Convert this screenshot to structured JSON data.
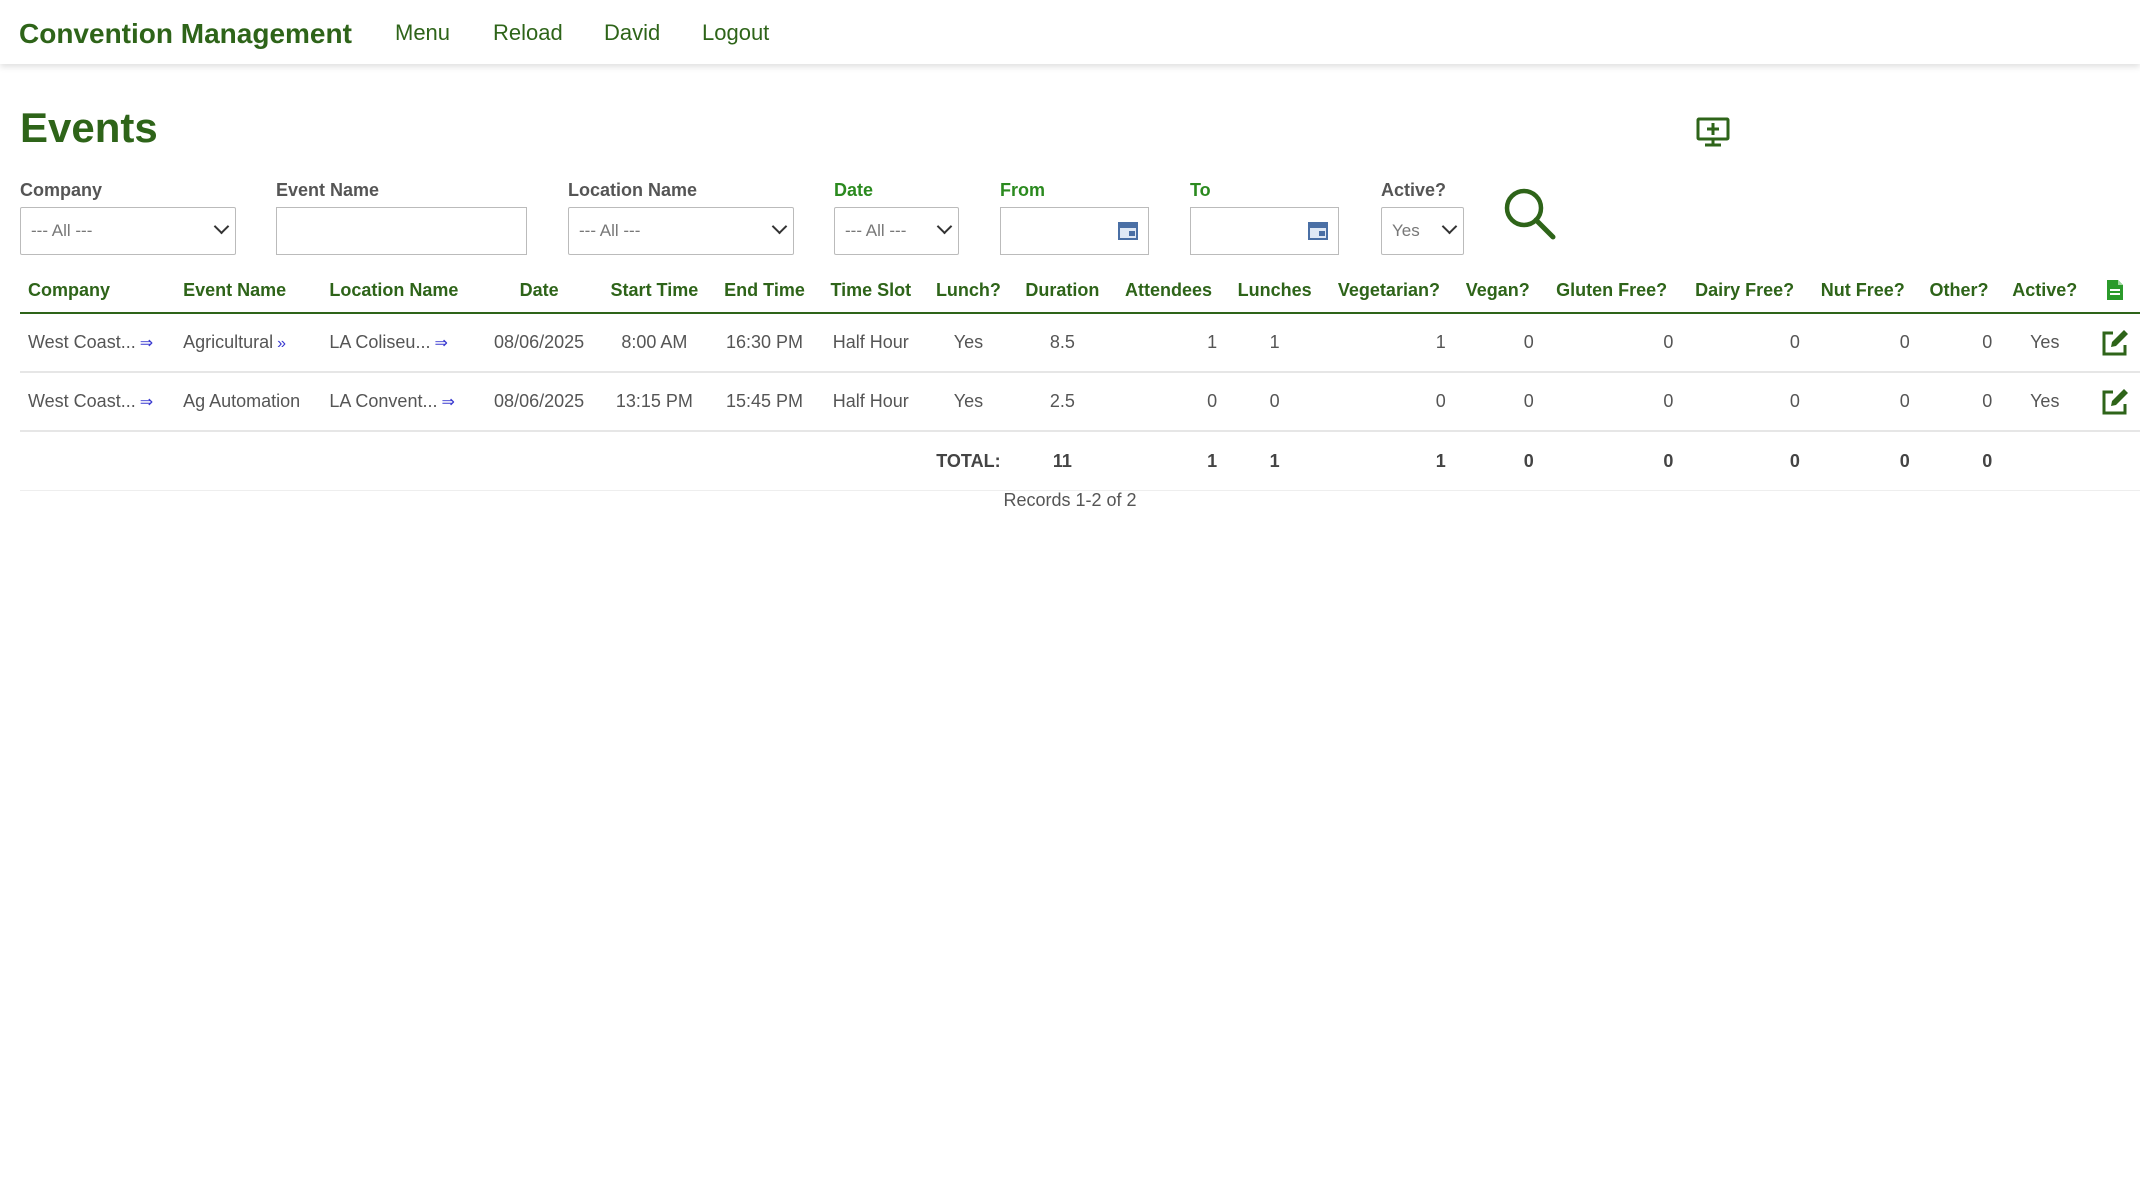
{
  "app": {
    "title": "Convention Management"
  },
  "nav": {
    "menu": "Menu",
    "reload": "Reload",
    "user": "David",
    "logout": "Logout"
  },
  "page": {
    "title": "Events"
  },
  "filters": {
    "company": {
      "label": "Company",
      "value": "--- All ---"
    },
    "event_name": {
      "label": "Event Name",
      "value": ""
    },
    "location_name": {
      "label": "Location Name",
      "value": "--- All ---"
    },
    "date": {
      "label": "Date",
      "value": "--- All ---"
    },
    "from": {
      "label": "From",
      "value": ""
    },
    "to": {
      "label": "To",
      "value": ""
    },
    "active": {
      "label": "Active?",
      "value": "Yes"
    }
  },
  "table": {
    "headers": [
      "Company",
      "Event Name",
      "Location Name",
      "Date",
      "Start Time",
      "End Time",
      "Time Slot",
      "Lunch?",
      "Duration",
      "Attendees",
      "Lunches",
      "Vegetarian?",
      "Vegan?",
      "Gluten Free?",
      "Dairy Free?",
      "Nut Free?",
      "Other?",
      "Active?"
    ],
    "rows": [
      [
        "West Coast...",
        "Agricultural",
        "LA Coliseu...",
        "08/06/2025",
        "8:00 AM",
        "16:30 PM",
        "Half Hour",
        "Yes",
        "8.5",
        "1",
        "1",
        "1",
        "0",
        "0",
        "0",
        "0",
        "0",
        "Yes"
      ],
      [
        "West Coast...",
        "Ag Automation",
        "LA Convent...",
        "08/06/2025",
        "13:15 PM",
        "15:45 PM",
        "Half Hour",
        "Yes",
        "2.5",
        "0",
        "0",
        "0",
        "0",
        "0",
        "0",
        "0",
        "0",
        "Yes"
      ]
    ],
    "total": {
      "label": "TOTAL:",
      "duration": "11",
      "attendees": "1",
      "lunches": "1",
      "vegetarian": "1",
      "vegan": "0",
      "gluten_free": "0",
      "dairy_free": "0",
      "nut_free": "0",
      "other": "0"
    }
  },
  "footer": {
    "records": "Records 1-2 of 2"
  },
  "colors": {
    "brand": "#2e6419",
    "date": "#2b8a1f",
    "link_arrow": "#3a3ad0"
  },
  "icons": {
    "add": "add-screen-icon",
    "search": "search-icon",
    "export": "document-icon",
    "edit": "edit-icon",
    "calendar": "calendar-icon",
    "arrow": "right-arrow-icon",
    "chevron": "double-chevron-icon"
  }
}
